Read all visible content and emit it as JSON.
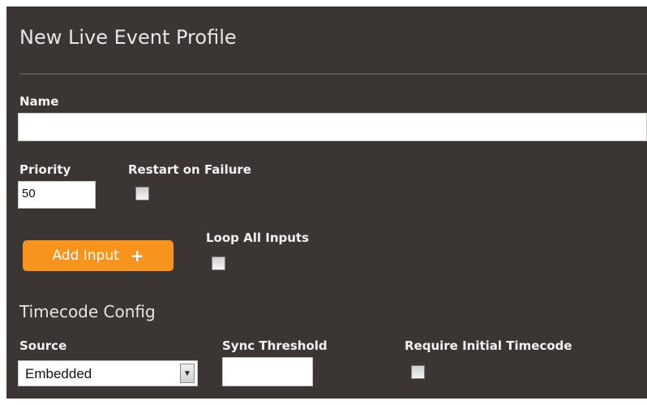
{
  "form": {
    "title": "New Live Event Profile",
    "name": {
      "label": "Name",
      "value": ""
    },
    "priority": {
      "label": "Priority",
      "value": "50"
    },
    "restart_on_failure": {
      "label": "Restart on Failure",
      "checked": false
    },
    "add_input": {
      "label": "Add Input",
      "icon": "plus-icon",
      "icon_glyph": "+"
    },
    "loop_all_inputs": {
      "label": "Loop All Inputs",
      "checked": false
    }
  },
  "timecode": {
    "title": "Timecode Config",
    "source": {
      "label": "Source",
      "selected": "Embedded",
      "icon": "chevron-down-icon",
      "icon_glyph": "▼"
    },
    "sync_threshold": {
      "label": "Sync Threshold",
      "value": ""
    },
    "require_initial_timecode": {
      "label": "Require Initial Timecode",
      "checked": false
    }
  },
  "colors": {
    "panel_bg": "#3b3634",
    "accent": "#f7941d",
    "label_text": "#f2f2f2"
  }
}
